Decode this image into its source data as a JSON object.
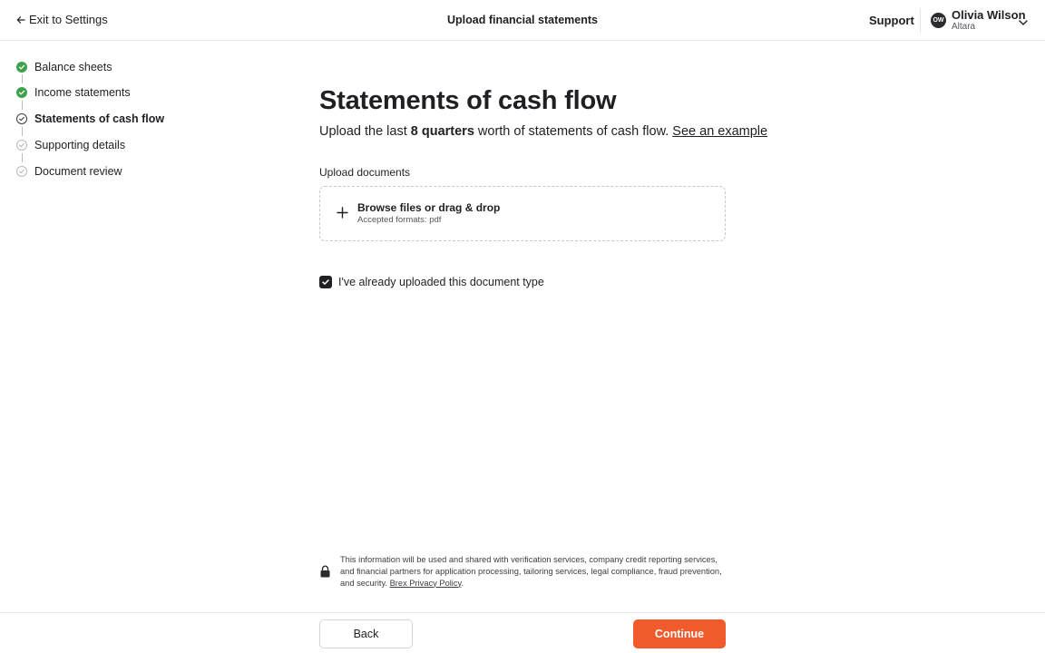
{
  "header": {
    "exit_label": "Exit to Settings",
    "title": "Upload financial statements",
    "support_label": "Support",
    "user": {
      "initials": "OW",
      "name": "Olivia Wilson",
      "org": "Altara"
    }
  },
  "steps": [
    {
      "label": "Balance sheets",
      "status": "done"
    },
    {
      "label": "Income statements",
      "status": "done"
    },
    {
      "label": "Statements of cash flow",
      "status": "current"
    },
    {
      "label": "Supporting details",
      "status": "pending"
    },
    {
      "label": "Document review",
      "status": "pending"
    }
  ],
  "main": {
    "title": "Statements of cash flow",
    "subtitle": {
      "prefix": "Upload the last ",
      "highlight": "8 quarters",
      "suffix": " worth of statements of cash flow. ",
      "link": "See an example"
    },
    "upload_label": "Upload documents",
    "dropzone": {
      "title": "Browse files or drag & drop",
      "subtitle": "Accepted formats: pdf"
    },
    "checkbox": {
      "label": "I've already uploaded this document type",
      "checked": true
    }
  },
  "disclosure": {
    "text": "This information will be used and shared with verification services, company credit reporting services, and financial partners for application processing, tailoring services, legal compliance, fraud prevention, and security. ",
    "link": "Brex Privacy Policy",
    "trailing": "."
  },
  "footer": {
    "back_label": "Back",
    "continue_label": "Continue"
  },
  "colors": {
    "accent": "#f15a2b",
    "step_done": "#3fa04e",
    "text": "#1f1f24"
  }
}
